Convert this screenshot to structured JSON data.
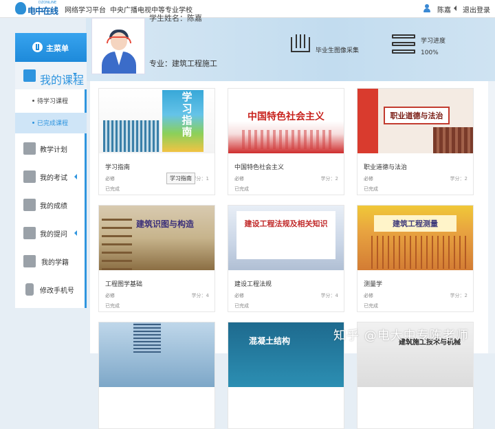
{
  "topbar": {
    "logo_en": "DZONLINE",
    "logo_cn": "电中在线",
    "platform": "网络学习平台",
    "school": "中央广播电视中等专业学校",
    "user_name": "陈嘉",
    "logout": "退出登录"
  },
  "profile": {
    "cut_text": "学生姓名：陈嘉",
    "major": "专业：建筑工程施工",
    "graduation_photo": "毕业生图像采集",
    "progress_label": "学习进度",
    "progress_value": "100%"
  },
  "sidebar": {
    "header": "主菜单",
    "my_courses": "我的课程",
    "sub_items": [
      "待学习课程",
      "已完成课程"
    ],
    "items": [
      {
        "label": "教学计划",
        "icon": "calendar-icon"
      },
      {
        "label": "我的考试",
        "icon": "exam-icon"
      },
      {
        "label": "我的成绩",
        "icon": "grades-icon"
      },
      {
        "label": "我的提问",
        "icon": "question-icon"
      },
      {
        "label": "我的学籍",
        "icon": "student-record-icon"
      },
      {
        "label": "修改手机号",
        "icon": "phone-icon"
      }
    ]
  },
  "courses": [
    {
      "title": "学习指南",
      "type": "必修",
      "credit": "学分：1",
      "status": "已完成",
      "cover_text": "学习指南"
    },
    {
      "title": "中国特色社会主义",
      "type": "必修",
      "credit": "学分：2",
      "status": "已完成",
      "cover_text": "中国特色社会主义"
    },
    {
      "title": "职业道德与法治",
      "type": "必修",
      "credit": "学分：2",
      "status": "已完成",
      "cover_text": "职业道德与法治"
    },
    {
      "title": "工程图学基础",
      "type": "必修",
      "credit": "学分：4",
      "status": "已完成",
      "cover_text": "建筑识图与构造"
    },
    {
      "title": "建设工程法规",
      "type": "必修",
      "credit": "学分：4",
      "status": "已完成",
      "cover_text": "建设工程法规及相关知识"
    },
    {
      "title": "测量学",
      "type": "必修",
      "credit": "学分：2",
      "status": "已完成",
      "cover_text": "建筑工程测量"
    },
    {
      "cover_text": ""
    },
    {
      "cover_text": "混凝土结构"
    },
    {
      "cover_text": "建筑施工技术与机械"
    }
  ],
  "tooltip": "学习指南",
  "watermark": "知乎 @电大中专陈老师"
}
